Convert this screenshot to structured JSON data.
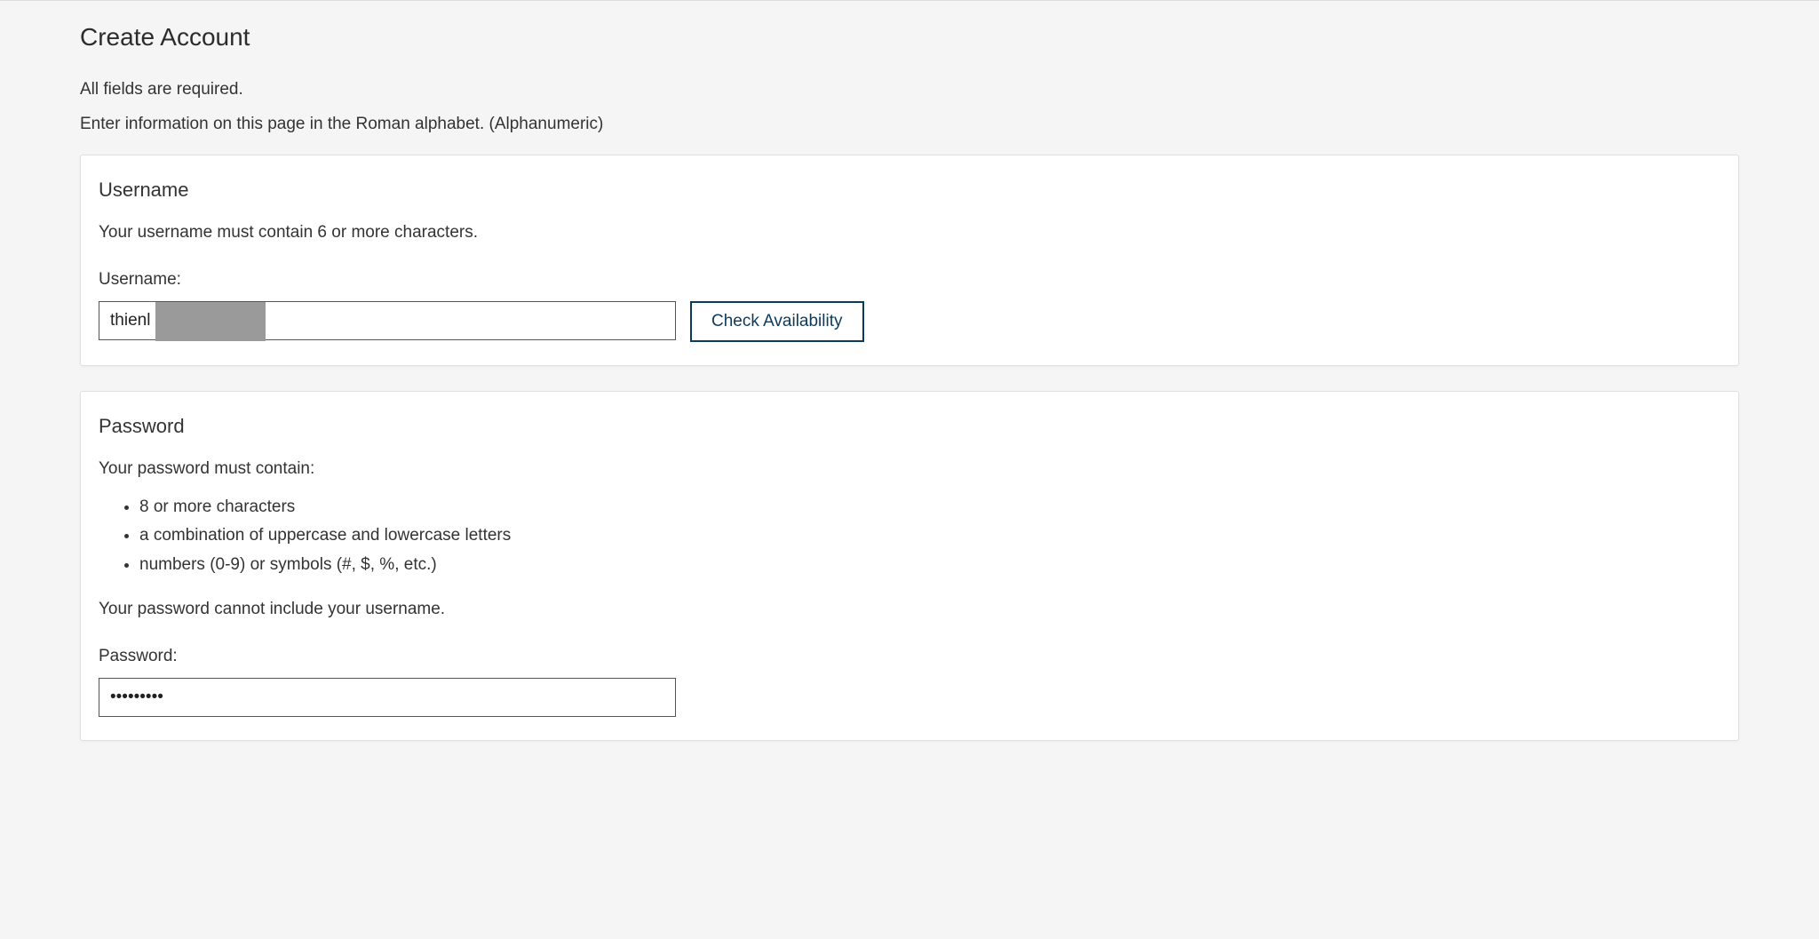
{
  "header": {
    "title": "Create Account",
    "required_note": "All fields are required.",
    "alphabet_note": "Enter information on this page in the Roman alphabet. (Alphanumeric)"
  },
  "username": {
    "section_title": "Username",
    "hint": "Your username must contain 6 or more characters.",
    "label": "Username:",
    "value": "thienl",
    "check_button": "Check Availability"
  },
  "password": {
    "section_title": "Password",
    "intro": "Your password must contain:",
    "requirements": [
      "8 or more characters",
      "a combination of uppercase and lowercase letters",
      "numbers (0-9) or symbols (#, $, %, etc.)"
    ],
    "exclusion_note": "Your password cannot include your username.",
    "label": "Password:",
    "value": "•••••••••"
  }
}
